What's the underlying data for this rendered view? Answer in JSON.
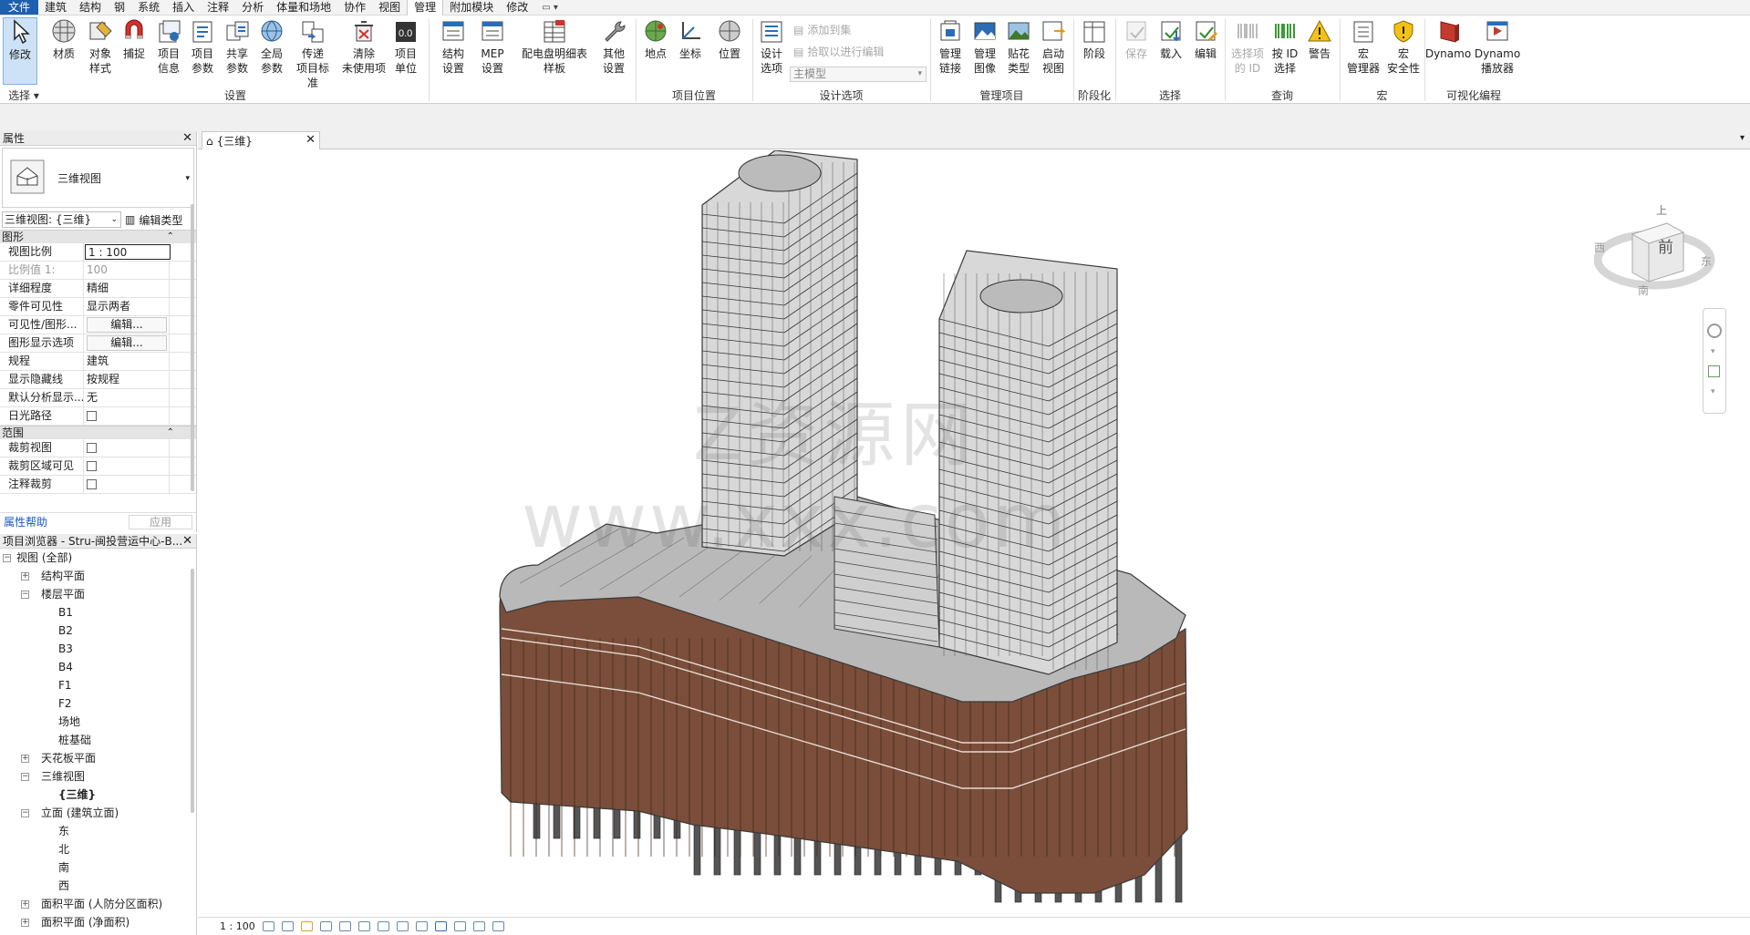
{
  "menu": {
    "file": "文件",
    "items": [
      "建筑",
      "结构",
      "钢",
      "系统",
      "插入",
      "注释",
      "分析",
      "体量和场地",
      "协作",
      "视图",
      "管理",
      "附加模块",
      "修改"
    ],
    "active_index": 10,
    "extra": "▭ ▾"
  },
  "ribbon": {
    "buttons": {
      "modify": "修改",
      "material": "材质",
      "object_style_1": "对象",
      "object_style_2": "样式",
      "snap": "捕捉",
      "proj_info_1": "项目",
      "proj_info_2": "信息",
      "proj_param_1": "项目",
      "proj_param_2": "参数",
      "shared_param_1": "共享",
      "shared_param_2": "参数",
      "global_param_1": "全局",
      "global_param_2": "参数",
      "transfer_1": "传递",
      "transfer_2": "项目标准",
      "purge_1": "清除",
      "purge_2": "未使用项",
      "proj_units_1": "项目",
      "proj_units_2": "单位",
      "struct_set_1": "结构",
      "struct_set_2": "设置",
      "mep_1": "MEP",
      "mep_2": "设置",
      "panel_1": "配电盘明细表",
      "panel_2": "样板",
      "other_1": "其他",
      "other_2": "设置",
      "location": "地点",
      "coords": "坐标",
      "position": "位置",
      "design_opt_1": "设计",
      "design_opt_2": "选项",
      "add_to_set": "添加到集",
      "pick_to_edit": "拾取以进行编辑",
      "main_model": "主模型",
      "manage_links_1": "管理",
      "manage_links_2": "链接",
      "manage_images_1": "管理",
      "manage_images_2": "图像",
      "decal_1": "贴花",
      "decal_2": "类型",
      "starting_view_1": "启动",
      "starting_view_2": "视图",
      "phases": "阶段",
      "save": "保存",
      "load": "载入",
      "edit": "编辑",
      "select_ids_1": "选择项",
      "select_ids_2": "的 ID",
      "select_by_id_1": "按 ID",
      "select_by_id_2": "选择",
      "warnings": "警告",
      "macro_mgr_1": "宏",
      "macro_mgr_2": "管理器",
      "macro_sec_1": "宏",
      "macro_sec_2": "安全性",
      "dynamo": "Dynamo",
      "dynamo_player_1": "Dynamo",
      "dynamo_player_2": "播放器"
    },
    "groups": {
      "select": "选择 ▾",
      "settings": "设置",
      "project_location": "项目位置",
      "design_options": "设计选项",
      "manage_project": "管理项目",
      "phasing": "阶段化",
      "selection": "选择",
      "inquiry": "查询",
      "macros": "宏",
      "visual_programming": "可视化编程"
    }
  },
  "properties": {
    "title": "属性",
    "type_name": "三维视图",
    "view_selector": "三维视图: {三维}",
    "edit_type": "编辑类型",
    "section_graphics": "图形",
    "rows": [
      {
        "k": "视图比例",
        "v": "1 : 100"
      },
      {
        "k": "比例值 1:",
        "v": "100"
      },
      {
        "k": "详细程度",
        "v": "精细"
      },
      {
        "k": "零件可见性",
        "v": "显示两者"
      },
      {
        "k": "可见性/图形...",
        "v": "编辑..."
      },
      {
        "k": "图形显示选项",
        "v": "编辑..."
      },
      {
        "k": "规程",
        "v": "建筑"
      },
      {
        "k": "显示隐藏线",
        "v": "按规程"
      },
      {
        "k": "默认分析显示...",
        "v": "无"
      },
      {
        "k": "日光路径",
        "v": ""
      }
    ],
    "section_extents": "范围",
    "extent_rows": [
      {
        "k": "裁剪视图"
      },
      {
        "k": "裁剪区域可见"
      },
      {
        "k": "注释裁剪"
      }
    ],
    "help_link": "属性帮助",
    "apply": "应用"
  },
  "browser": {
    "title": "项目浏览器 - Stru-闽投营运中心-B...",
    "tree": [
      {
        "label": "视图 (全部)",
        "level": 0,
        "toggle": "−"
      },
      {
        "label": "结构平面",
        "level": 1,
        "toggle": "+"
      },
      {
        "label": "楼层平面",
        "level": 1,
        "toggle": "−"
      },
      {
        "label": "B1",
        "level": 2
      },
      {
        "label": "B2",
        "level": 2
      },
      {
        "label": "B3",
        "level": 2
      },
      {
        "label": "B4",
        "level": 2
      },
      {
        "label": "F1",
        "level": 2
      },
      {
        "label": "F2",
        "level": 2
      },
      {
        "label": "场地",
        "level": 2
      },
      {
        "label": "桩基础",
        "level": 2
      },
      {
        "label": "天花板平面",
        "level": 1,
        "toggle": "+"
      },
      {
        "label": "三维视图",
        "level": 1,
        "toggle": "−"
      },
      {
        "label": "{三维}",
        "level": 2,
        "bold": true
      },
      {
        "label": "立面 (建筑立面)",
        "level": 1,
        "toggle": "−"
      },
      {
        "label": "东",
        "level": 2
      },
      {
        "label": "北",
        "level": 2
      },
      {
        "label": "南",
        "level": 2
      },
      {
        "label": "西",
        "level": 2
      },
      {
        "label": "面积平面 (人防分区面积)",
        "level": 1,
        "toggle": "+"
      },
      {
        "label": "面积平面 (净面积)",
        "level": 1,
        "toggle": "+"
      }
    ]
  },
  "view": {
    "tab_title": "{三维}",
    "viewcube": {
      "top": "上",
      "front": "前",
      "right": "东",
      "left": "西",
      "bottom": "南"
    },
    "watermark_line1": "Z资源网",
    "watermark_line2": "www.xxx.com"
  },
  "statusbar": {
    "scale": "1 : 100"
  },
  "colors": {
    "accent": "#1f5fb0",
    "facade": "#7a4e3a",
    "roof": "#b9b9b9",
    "frame": "#3a3a3a"
  }
}
